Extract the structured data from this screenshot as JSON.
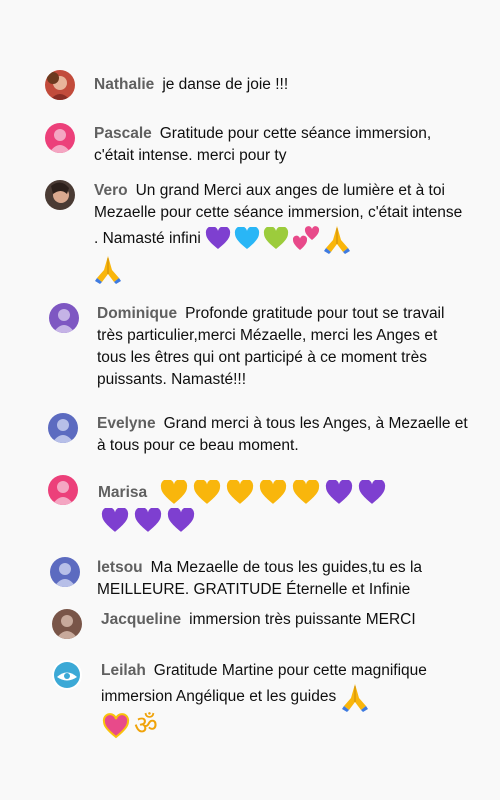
{
  "comments": [
    {
      "author": "Nathalie",
      "text": "je danse de joie !!!",
      "emojis": []
    },
    {
      "author": "Pascale",
      "text": "Gratitude pour cette séance immersion, c'était intense. merci pour ty",
      "emojis": []
    },
    {
      "author": "Vero",
      "text": "Un grand Merci aux anges de lumière et à toi Mezaelle pour cette séance immersion, c'était intense . Namasté infini",
      "emojis": [
        "purple-heart",
        "blue-heart",
        "green-heart",
        "two-hearts",
        "folded-hands",
        "folded-hands"
      ]
    },
    {
      "author": "Dominique",
      "text": "Profonde gratitude pour tout se travail très particulier,merci Mézaelle, merci les Anges et tous les êtres qui ont participé à ce moment très puissants. Namasté!!!",
      "emojis": []
    },
    {
      "author": "Evelyne",
      "text": "Grand merci à tous les Anges, à Mezaelle et à tous pour ce beau moment.",
      "emojis": []
    },
    {
      "author": "Marisa",
      "text": "",
      "emojis": [
        "yellow-heart",
        "yellow-heart",
        "yellow-heart",
        "yellow-heart",
        "yellow-heart",
        "purple-heart",
        "purple-heart",
        "purple-heart",
        "purple-heart",
        "purple-heart"
      ]
    },
    {
      "author": "letsou",
      "text": "Ma Mezaelle de tous les guides,tu es la MEILLEURE. GRATITUDE Éternelle et Infinie",
      "emojis": []
    },
    {
      "author": "Jacqueline",
      "text": "immersion très puissante MERCI",
      "emojis": []
    },
    {
      "author": "Leilah",
      "text": "Gratitude Martine pour cette magnifique immersion Angélique et les guides",
      "emojis": [
        "folded-hands",
        "sparkling-heart",
        "om-symbol"
      ]
    }
  ],
  "colors": {
    "author": "#606060",
    "text": "#0f0f0f",
    "background": "#f9f9f9",
    "avatar_pink": "#ec407a",
    "avatar_purple": "#7e57c2",
    "avatar_blue": "#5c6bc0",
    "avatar_brown": "#795548",
    "purple_heart": "#7e3fd0",
    "blue_heart": "#29b6f6",
    "green_heart": "#9ccc3c",
    "yellow_heart": "#f9b60c",
    "pink_heart": "#e84a8a"
  }
}
